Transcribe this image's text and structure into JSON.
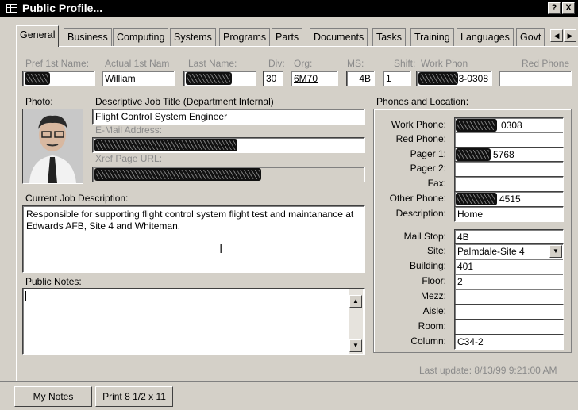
{
  "window": {
    "title": "Public Profile...",
    "help_btn": "?",
    "close_btn": "X"
  },
  "tabs": [
    "General",
    "Business",
    "Computing",
    "Systems",
    "Programs",
    "Parts",
    "Documents",
    "Tasks",
    "Training",
    "Languages",
    "Govt"
  ],
  "header_fields": {
    "pref_first_label": "Pref 1st Name:",
    "actual_first_label": "Actual 1st Nam",
    "actual_first_value": "William",
    "last_name_label": "Last Name:",
    "div_label": "Div:",
    "div_value": "30",
    "org_label": "Org:",
    "org_value": "6M70",
    "ms_label": "MS:",
    "ms_value": "4B",
    "shift_label": "Shift:",
    "shift_value": "1",
    "work_phone_label": "Work Phon",
    "work_phone_value": "3-0308",
    "red_phone_label": "Red Phone"
  },
  "left": {
    "photo_label": "Photo:",
    "job_title_label": "Descriptive Job Title (Department Internal)",
    "job_title_value": "Flight Control System Engineer",
    "email_label": "E-Mail Address:",
    "xref_label": "Xref Page URL:",
    "job_desc_label": "Current Job Description:",
    "job_desc_value": "Responsible for supporting flight control system flight test and maintanance at Edwards AFB, Site 4 and Whiteman.",
    "public_notes_label": "Public Notes:"
  },
  "phones": {
    "group_label": "Phones and Location:",
    "work_phone_label": "Work Phone:",
    "work_phone_value": "0308",
    "red_phone_label": "Red Phone:",
    "pager1_label": "Pager 1:",
    "pager1_value": "5768",
    "pager2_label": "Pager 2:",
    "fax_label": "Fax:",
    "other_phone_label": "Other Phone:",
    "other_phone_value": "4515",
    "description_label": "Description:",
    "description_value": "Home",
    "mail_stop_label": "Mail Stop:",
    "mail_stop_value": "4B",
    "site_label": "Site:",
    "site_value": "Palmdale-Site 4",
    "building_label": "Building:",
    "building_value": "401",
    "floor_label": "Floor:",
    "floor_value": "2",
    "mezz_label": "Mezz:",
    "aisle_label": "Aisle:",
    "room_label": "Room:",
    "column_label": "Column:",
    "column_value": "C34-2"
  },
  "status": {
    "last_update": "Last update: 8/13/99 9:21:00 AM"
  },
  "buttons": {
    "my_notes": "My Notes",
    "print": "Print 8 1/2 x 11"
  },
  "icons": {
    "app": "form-icon",
    "scroll_up": "arrow-up-icon",
    "scroll_down": "arrow-down-icon",
    "dropdown": "chevron-down-icon",
    "tab_left": "arrow-left-icon",
    "tab_right": "arrow-right-icon",
    "cursor": "text-cursor-icon"
  }
}
